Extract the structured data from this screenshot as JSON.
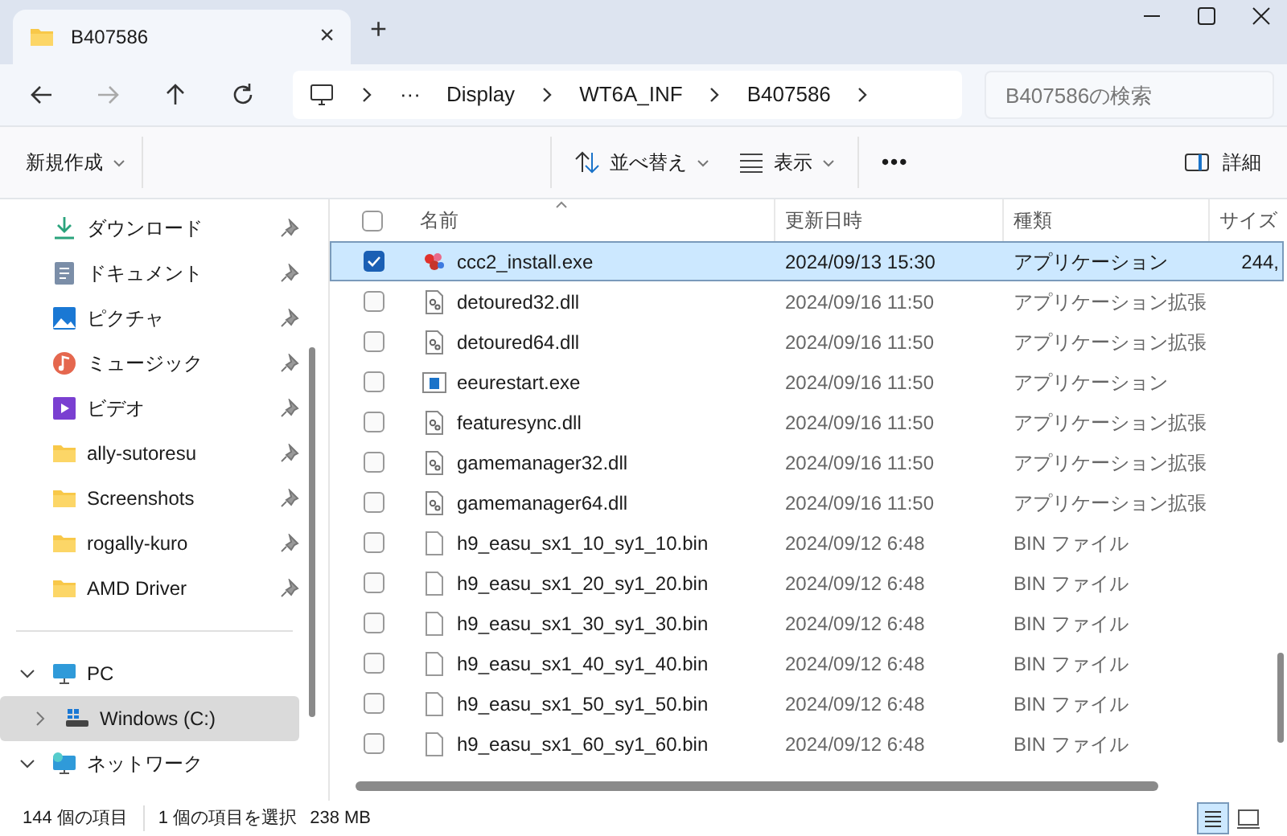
{
  "tab": {
    "title": "B407586",
    "close": "×",
    "new_tab": "+"
  },
  "address": {
    "more": "···",
    "crumbs": [
      "Display",
      "WT6A_INF",
      "B407586"
    ]
  },
  "search": {
    "placeholder": "B407586の検索"
  },
  "toolbar": {
    "new": "新規作成",
    "sort": "並べ替え",
    "view": "表示",
    "more": "•••",
    "details": "詳細"
  },
  "sidebar": {
    "quick": [
      {
        "label": "ダウンロード",
        "kind": "downloads",
        "pinned": true
      },
      {
        "label": "ドキュメント",
        "kind": "documents",
        "pinned": true
      },
      {
        "label": "ピクチャ",
        "kind": "pictures",
        "pinned": true
      },
      {
        "label": "ミュージック",
        "kind": "music",
        "pinned": true
      },
      {
        "label": "ビデオ",
        "kind": "videos",
        "pinned": true
      },
      {
        "label": "ally-sutoresu",
        "kind": "folder",
        "pinned": true
      },
      {
        "label": "Screenshots",
        "kind": "folder",
        "pinned": true
      },
      {
        "label": "rogally-kuro",
        "kind": "folder",
        "pinned": true
      },
      {
        "label": "AMD Driver",
        "kind": "folder",
        "pinned": true
      }
    ],
    "tree": [
      {
        "label": "PC",
        "kind": "pc",
        "expanded": true,
        "selected": false,
        "children": [
          {
            "label": "Windows (C:)",
            "kind": "drive",
            "expanded": false,
            "selected": true
          }
        ]
      },
      {
        "label": "ネットワーク",
        "kind": "network",
        "expanded": true,
        "selected": false
      }
    ]
  },
  "table": {
    "columns": [
      "名前",
      "更新日時",
      "種類",
      "サイズ"
    ],
    "rows": [
      {
        "name": "ccc2_install.exe",
        "kind": "setup",
        "date": "2024/09/13 15:30",
        "type": "アプリケーション",
        "size": "244,",
        "selected": true
      },
      {
        "name": "detoured32.dll",
        "kind": "dll",
        "date": "2024/09/16 11:50",
        "type": "アプリケーション拡張",
        "selected": false
      },
      {
        "name": "detoured64.dll",
        "kind": "dll",
        "date": "2024/09/16 11:50",
        "type": "アプリケーション拡張",
        "selected": false
      },
      {
        "name": "eeurestart.exe",
        "kind": "exe",
        "date": "2024/09/16 11:50",
        "type": "アプリケーション",
        "selected": false
      },
      {
        "name": "featuresync.dll",
        "kind": "dll",
        "date": "2024/09/16 11:50",
        "type": "アプリケーション拡張",
        "selected": false
      },
      {
        "name": "gamemanager32.dll",
        "kind": "dll",
        "date": "2024/09/16 11:50",
        "type": "アプリケーション拡張",
        "selected": false
      },
      {
        "name": "gamemanager64.dll",
        "kind": "dll",
        "date": "2024/09/16 11:50",
        "type": "アプリケーション拡張",
        "selected": false
      },
      {
        "name": "h9_easu_sx1_10_sy1_10.bin",
        "kind": "bin",
        "date": "2024/09/12 6:48",
        "type": "BIN ファイル",
        "selected": false
      },
      {
        "name": "h9_easu_sx1_20_sy1_20.bin",
        "kind": "bin",
        "date": "2024/09/12 6:48",
        "type": "BIN ファイル",
        "selected": false
      },
      {
        "name": "h9_easu_sx1_30_sy1_30.bin",
        "kind": "bin",
        "date": "2024/09/12 6:48",
        "type": "BIN ファイル",
        "selected": false
      },
      {
        "name": "h9_easu_sx1_40_sy1_40.bin",
        "kind": "bin",
        "date": "2024/09/12 6:48",
        "type": "BIN ファイル",
        "selected": false
      },
      {
        "name": "h9_easu_sx1_50_sy1_50.bin",
        "kind": "bin",
        "date": "2024/09/12 6:48",
        "type": "BIN ファイル",
        "selected": false
      },
      {
        "name": "h9_easu_sx1_60_sy1_60.bin",
        "kind": "bin",
        "date": "2024/09/12 6:48",
        "type": "BIN ファイル",
        "selected": false
      }
    ]
  },
  "status_bar": {
    "count": "144 個の項目",
    "selection": "1 個の項目を選択",
    "size": "238 MB",
    "views": [
      {
        "kind": "details",
        "selected": true
      },
      {
        "kind": "tiles",
        "selected": false
      }
    ]
  }
}
